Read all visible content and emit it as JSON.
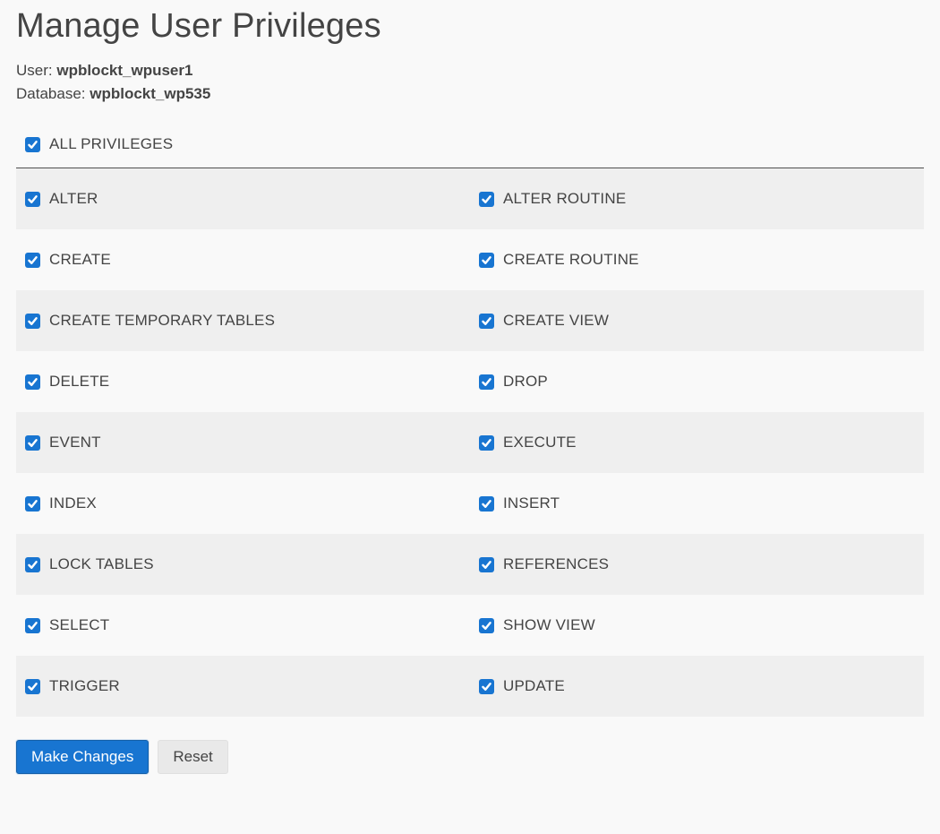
{
  "title": "Manage User Privileges",
  "meta": {
    "user_label": "User: ",
    "user_value": "wpblockt_wpuser1",
    "db_label": "Database: ",
    "db_value": "wpblockt_wp535"
  },
  "all_privileges": {
    "label": "ALL PRIVILEGES",
    "checked": true
  },
  "privileges": [
    {
      "label": "ALTER",
      "checked": true
    },
    {
      "label": "ALTER ROUTINE",
      "checked": true
    },
    {
      "label": "CREATE",
      "checked": true
    },
    {
      "label": "CREATE ROUTINE",
      "checked": true
    },
    {
      "label": "CREATE TEMPORARY TABLES",
      "checked": true
    },
    {
      "label": "CREATE VIEW",
      "checked": true
    },
    {
      "label": "DELETE",
      "checked": true
    },
    {
      "label": "DROP",
      "checked": true
    },
    {
      "label": "EVENT",
      "checked": true
    },
    {
      "label": "EXECUTE",
      "checked": true
    },
    {
      "label": "INDEX",
      "checked": true
    },
    {
      "label": "INSERT",
      "checked": true
    },
    {
      "label": "LOCK TABLES",
      "checked": true
    },
    {
      "label": "REFERENCES",
      "checked": true
    },
    {
      "label": "SELECT",
      "checked": true
    },
    {
      "label": "SHOW VIEW",
      "checked": true
    },
    {
      "label": "TRIGGER",
      "checked": true
    },
    {
      "label": "UPDATE",
      "checked": true
    }
  ],
  "buttons": {
    "submit": "Make Changes",
    "reset": "Reset"
  },
  "colors": {
    "accent": "#1875d1"
  }
}
